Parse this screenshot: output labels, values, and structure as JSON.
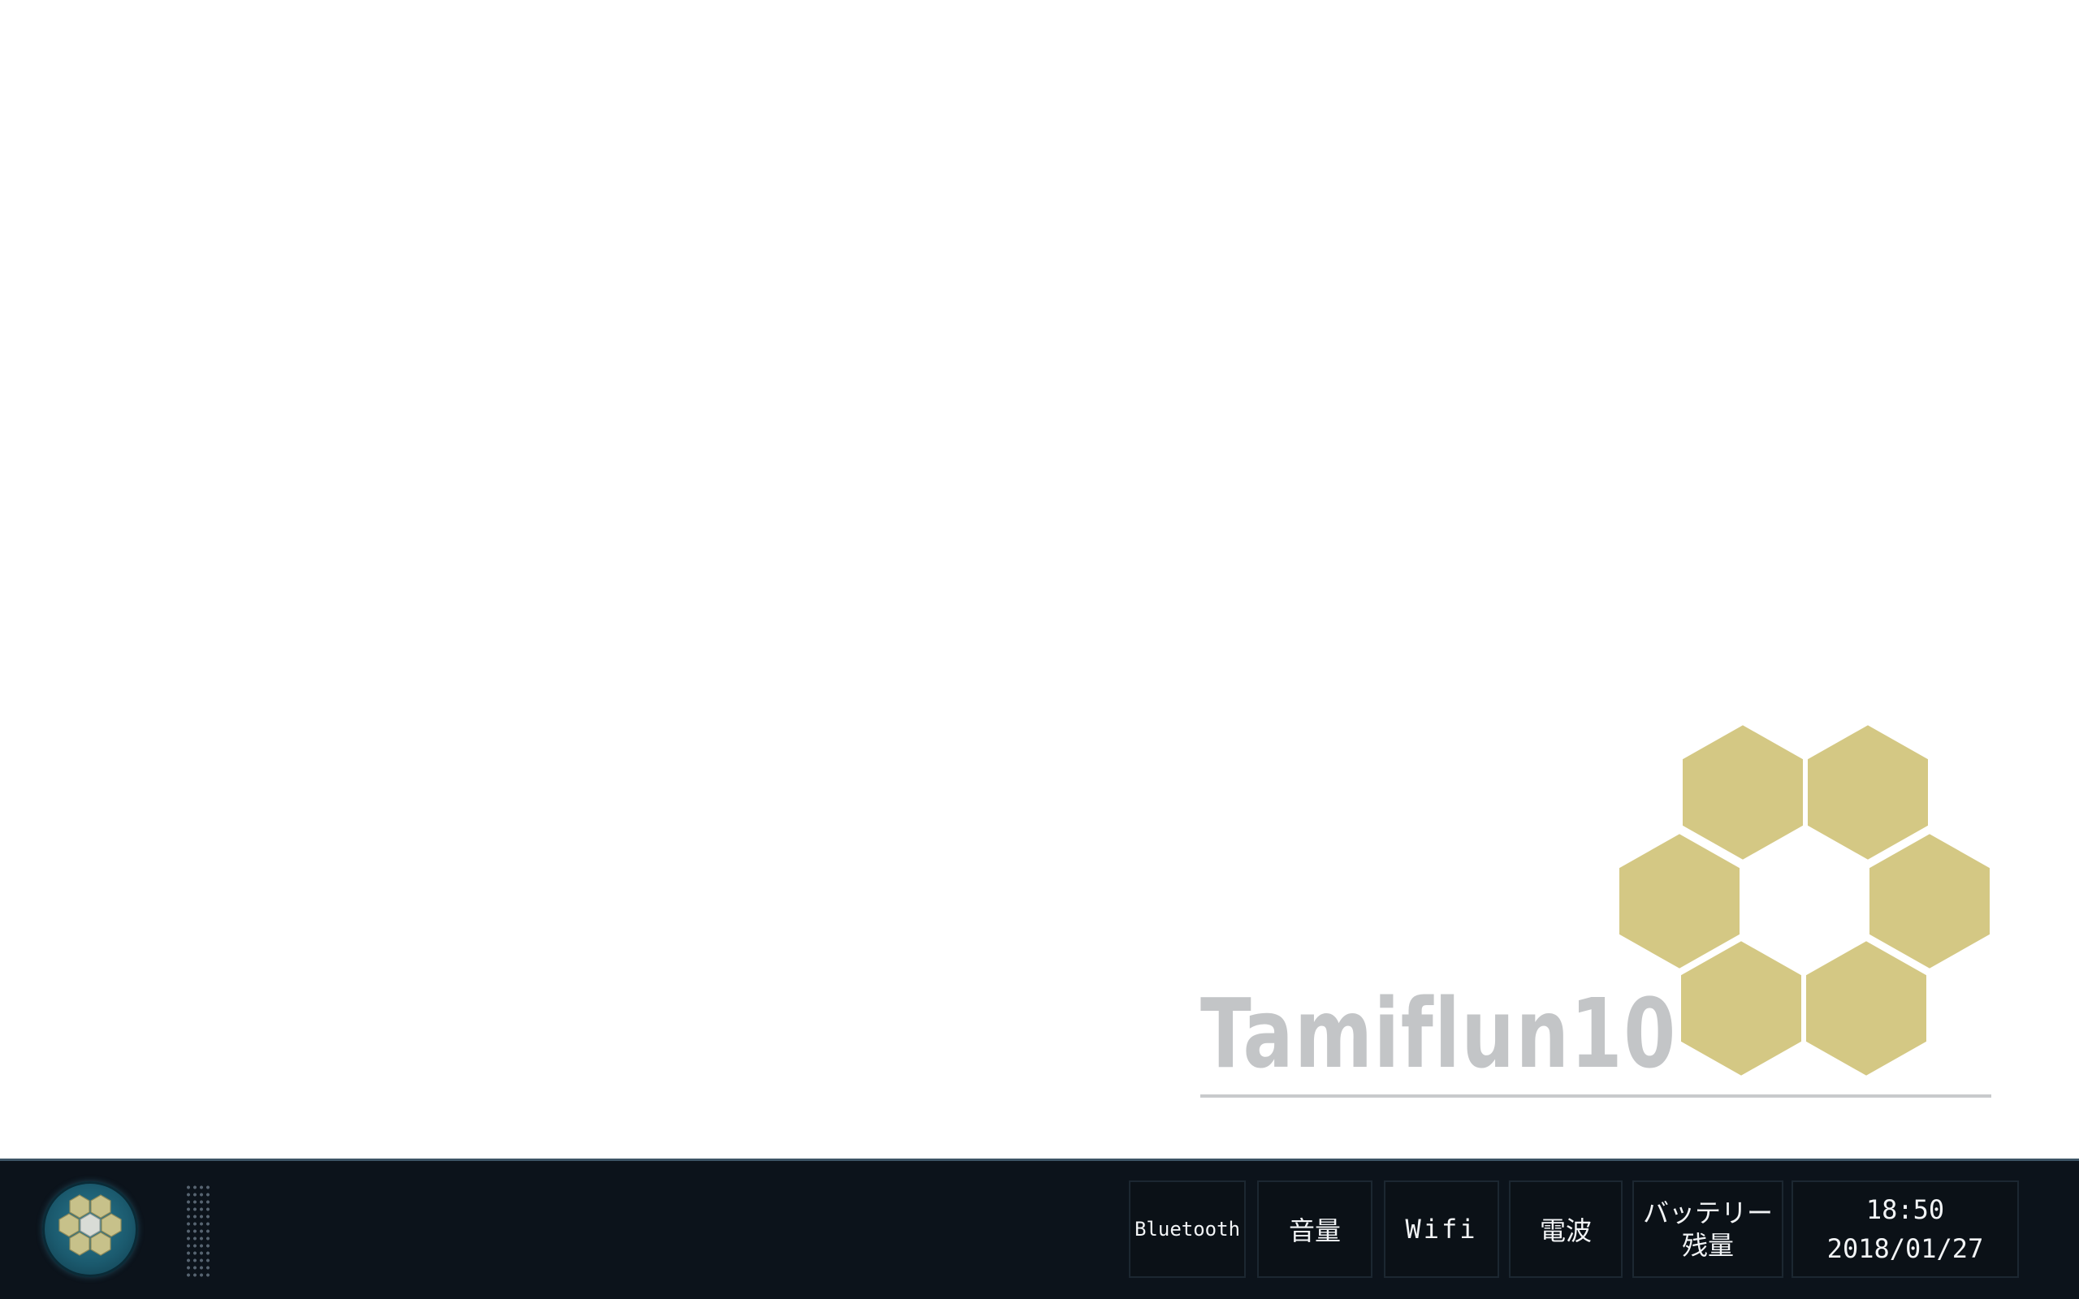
{
  "wallpaper": {
    "logo_text": "Tamiflun10",
    "logo_text_color": "#c3c5c7",
    "honeycomb_color": "#d4c884"
  },
  "taskbar": {
    "background_color": "#0c131b",
    "start_button": {
      "icon": "honeycomb-icon"
    },
    "grip": {
      "icon": "drag-handle-icon"
    },
    "tray": {
      "bluetooth_label": "Bluetooth",
      "volume_label": "音量",
      "wifi_label": "Wifi",
      "signal_label": "電波",
      "battery_label_line1": "バッテリー",
      "battery_label_line2": "残量"
    },
    "clock": {
      "time": "18:50",
      "date": "2018/01/27"
    }
  }
}
